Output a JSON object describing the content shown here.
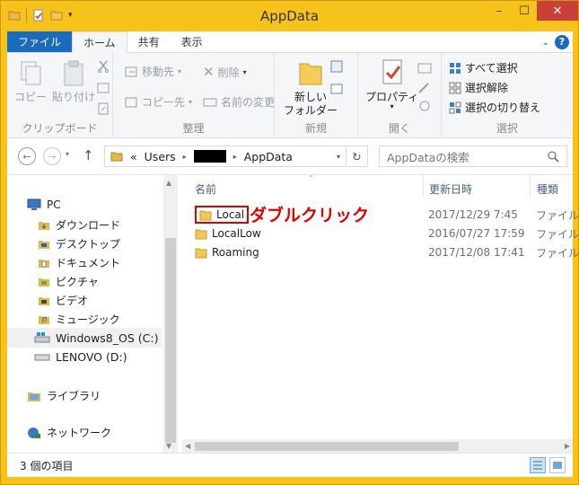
{
  "window": {
    "title": "AppData"
  },
  "tabs": [
    "ファイル",
    "ホーム",
    "共有",
    "表示"
  ],
  "ribbon": {
    "clipboard": {
      "copy": "コピー",
      "paste": "貼り付け",
      "label": "クリップボード"
    },
    "organize": {
      "move_to": "移動先",
      "copy_to": "コピー先",
      "delete": "削除",
      "rename": "名前の変更",
      "label": "整理"
    },
    "new": {
      "new_folder_line1": "新しい",
      "new_folder_line2": "フォルダー",
      "label": "新規"
    },
    "open": {
      "properties": "プロパティ",
      "label": "開く"
    },
    "select": {
      "select_all": "すべて選択",
      "select_none": "選択解除",
      "invert": "選択の切り替え",
      "label": "選択"
    }
  },
  "address": {
    "back": "←",
    "forward": "→",
    "up": "↑",
    "prefix": "«",
    "crumbs": [
      "Users",
      "AppData"
    ],
    "search_placeholder": "AppDataの検索"
  },
  "nav": {
    "pc": "PC",
    "items": [
      "ダウンロード",
      "デスクトップ",
      "ドキュメント",
      "ピクチャ",
      "ビデオ",
      "ミュージック"
    ],
    "drive_c": "Windows8_OS (C:)",
    "drive_d": "LENOVO (D:)",
    "libraries": "ライブラリ",
    "network": "ネットワーク"
  },
  "columns": {
    "name": "名前",
    "date": "更新日時",
    "type": "種類"
  },
  "files": [
    {
      "name": "Local",
      "date": "2017/12/29 7:45",
      "type": "ファイル"
    },
    {
      "name": "LocalLow",
      "date": "2016/07/27 17:59",
      "type": "ファイル"
    },
    {
      "name": "Roaming",
      "date": "2017/12/08 17:41",
      "type": "ファイル"
    }
  ],
  "annotation": "ダブルクリック",
  "status": {
    "count": "3 個の項目"
  },
  "colors": {
    "title_bar": "#f7c21a",
    "file_tab": "#1a6bbd",
    "annotation": "#e00000"
  }
}
